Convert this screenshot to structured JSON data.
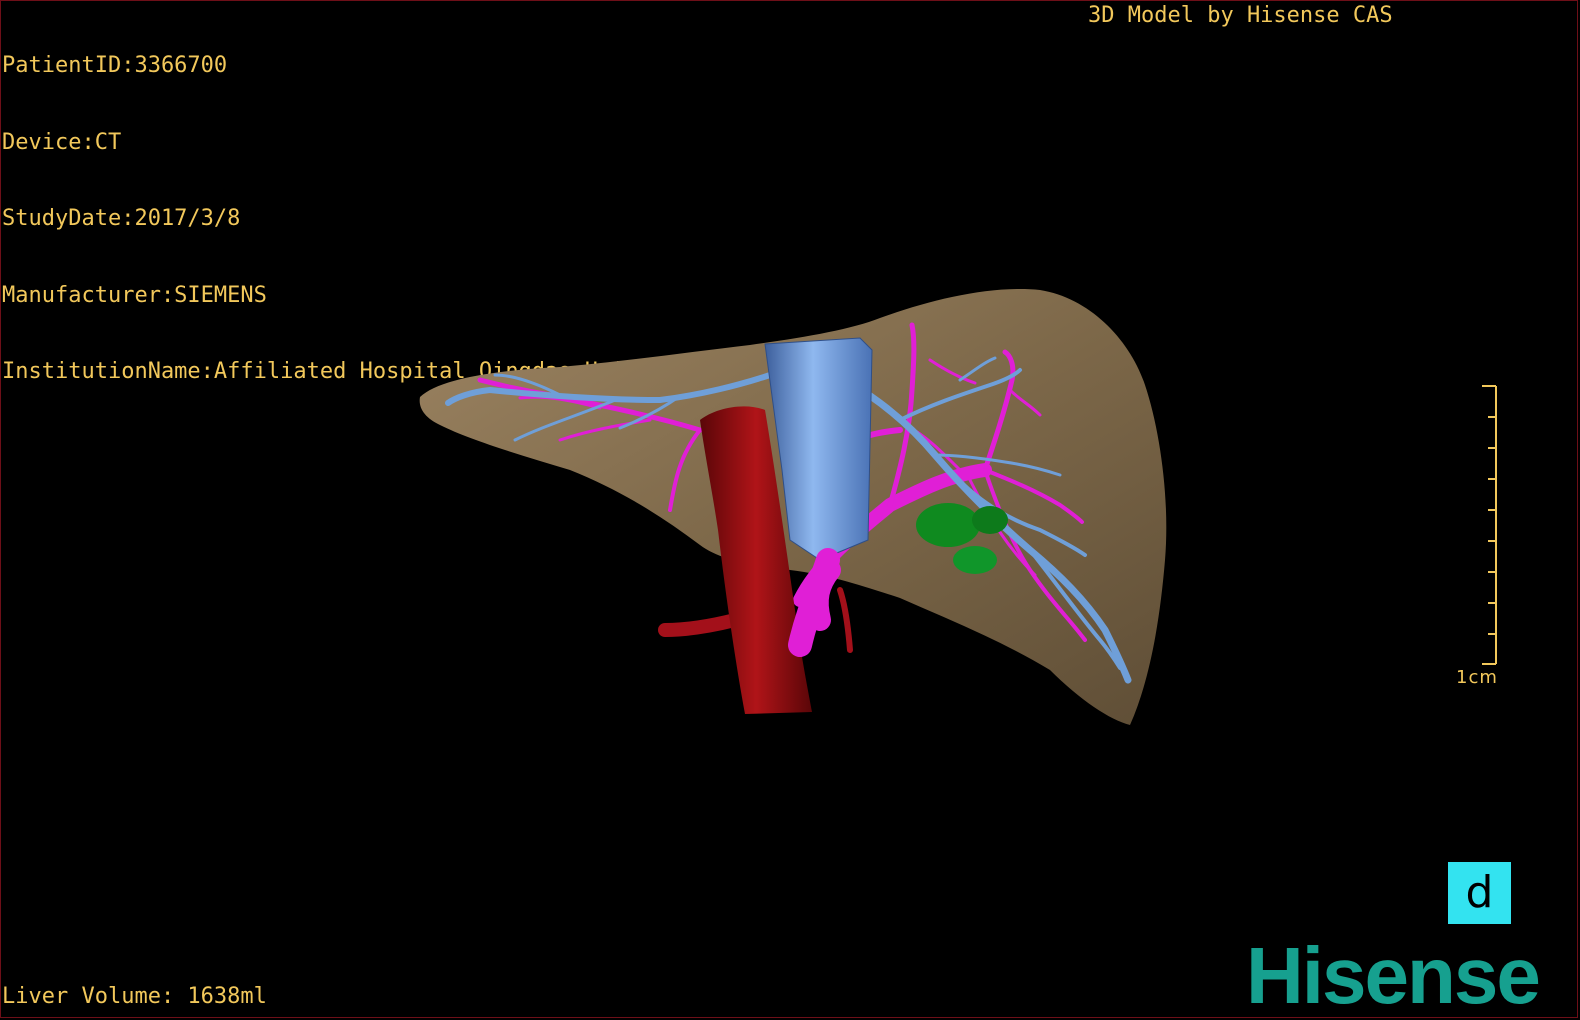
{
  "study": {
    "patient_id": "PatientID:3366700",
    "device": "Device:CT",
    "study_date": "StudyDate:2017/3/8",
    "manufacturer": "Manufacturer:SIEMENS",
    "institution": "InstitutionName:Affiliated Hospital Qingdao University-C"
  },
  "credit": "3D Model by Hisense CAS",
  "liver_volume": "Liver Volume: 1638ml",
  "scale_bar": {
    "label": "1cm",
    "ticks": 10
  },
  "view_badge": {
    "label": "d",
    "color": "#33e3f0"
  },
  "logo": {
    "text": "Hisense",
    "color": "#16a08f"
  },
  "colors": {
    "text": "#f2c85b",
    "liver": "#8a7355",
    "hepatic_vein": "#6f9fd8",
    "portal_vein": "#e01fd6",
    "ivc": "#9b0e10",
    "lesion": "#0f8a1f",
    "frame": "#6e0f18"
  },
  "structures": [
    "liver",
    "hepatic-vein",
    "portal-vein",
    "inferior-vena-cava",
    "hepatic-artery",
    "lesion"
  ]
}
